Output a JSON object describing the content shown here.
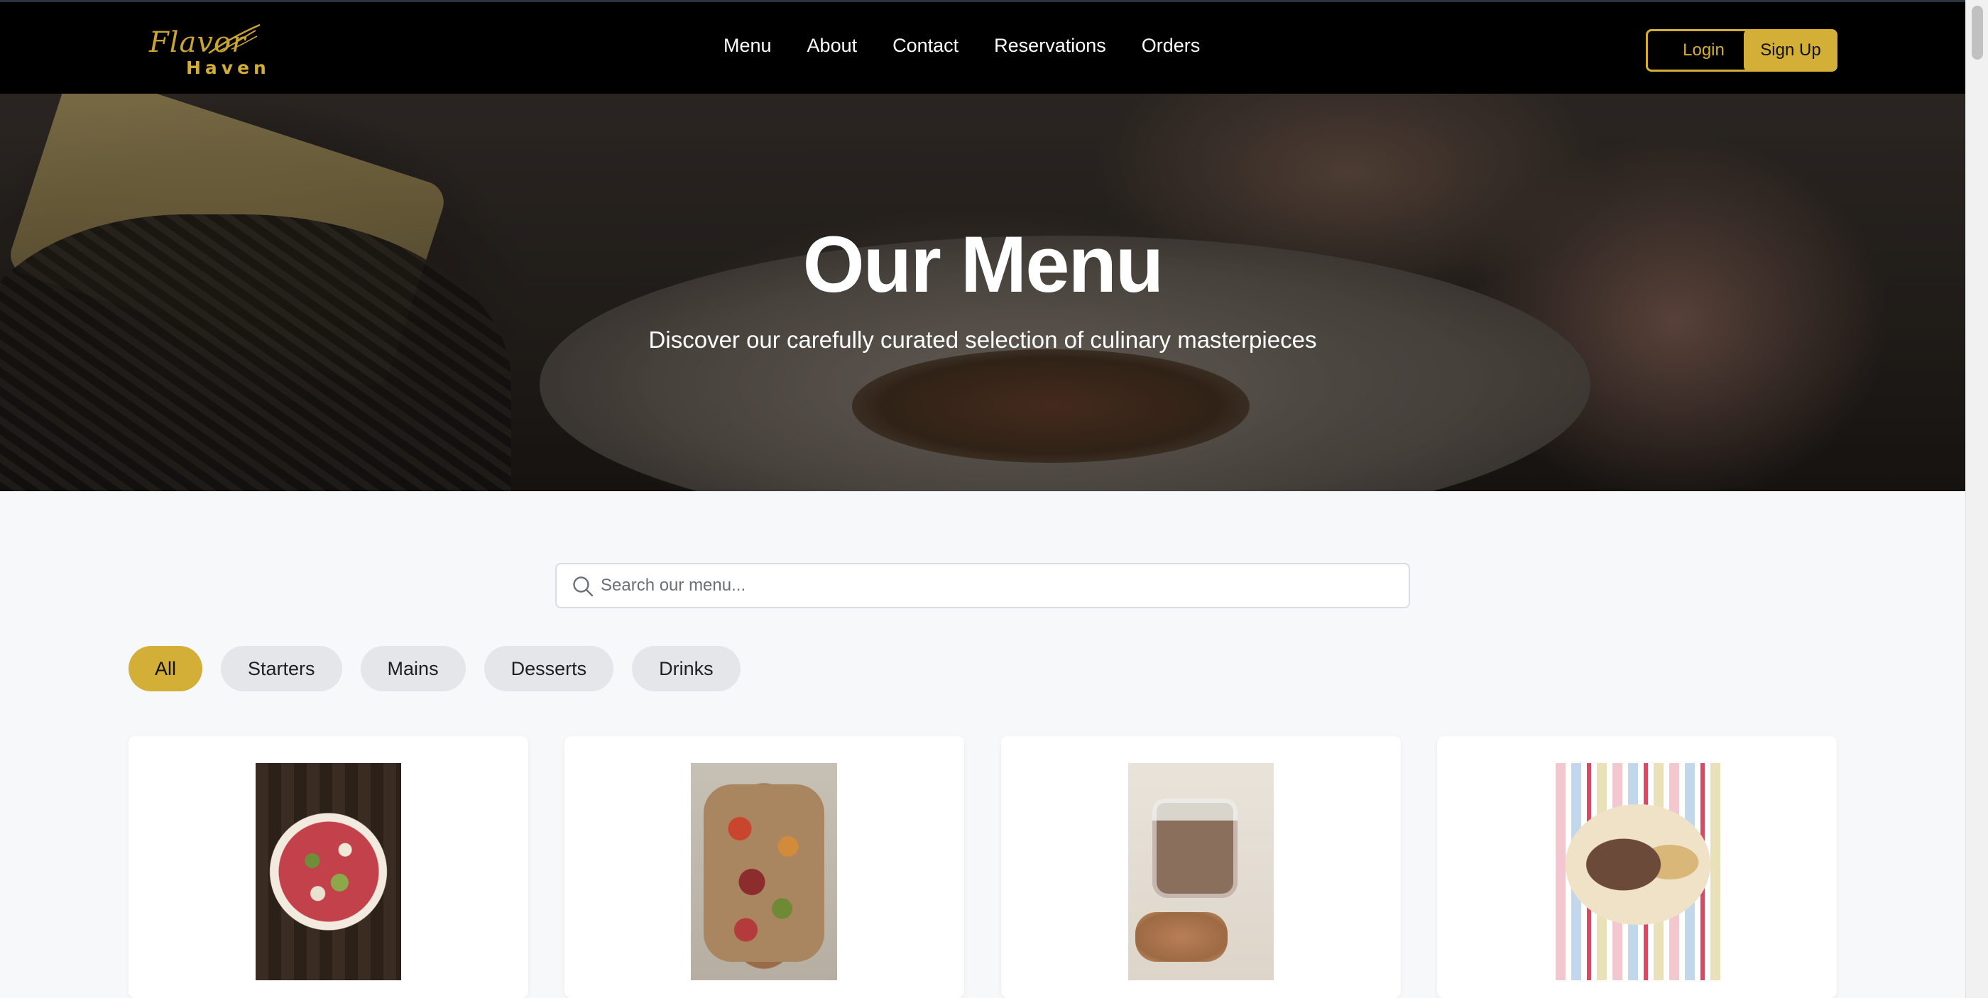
{
  "brand": {
    "script": "Flavor",
    "name": "Haven",
    "accent_color": "#d4af37"
  },
  "nav": {
    "links": [
      "Menu",
      "About",
      "Contact",
      "Reservations",
      "Orders"
    ],
    "login_label": "Login",
    "signup_label": "Sign Up"
  },
  "hero": {
    "title": "Our Menu",
    "subtitle": "Discover our carefully curated selection of culinary masterpieces"
  },
  "search": {
    "placeholder": "Search our menu...",
    "value": "",
    "icon": "search-icon"
  },
  "filters": {
    "items": [
      "All",
      "Starters",
      "Mains",
      "Desserts",
      "Drinks"
    ],
    "active": "All"
  },
  "menu_cards": [
    {
      "image": "beef-carpaccio-photo"
    },
    {
      "image": "charcuterie-board-photo"
    },
    {
      "image": "pate-jar-photo"
    },
    {
      "image": "pulled-meat-plate-photo"
    }
  ]
}
